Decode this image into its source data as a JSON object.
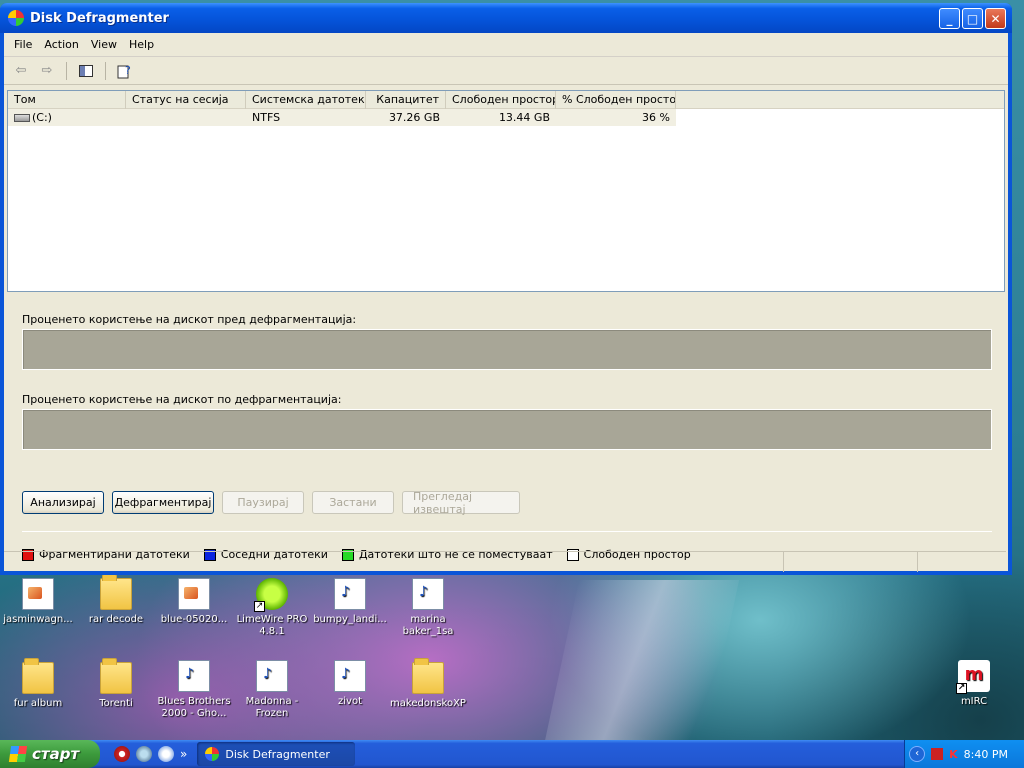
{
  "window": {
    "title": "Disk Defragmenter",
    "buttons": {
      "minimize": "_",
      "maximize": "□",
      "close": "✕"
    }
  },
  "menu": [
    "File",
    "Action",
    "View",
    "Help"
  ],
  "toolbar": {
    "back_icon": "back-arrow-icon",
    "forward_icon": "forward-arrow-icon",
    "show_hide_icon": "console-tree-icon",
    "help_icon": "help-icon"
  },
  "list": {
    "columns": [
      "Том",
      "Статус на сесија",
      "Системска датотека",
      "Капацитет",
      "Слободен простор",
      "% Слободен простор"
    ],
    "rows": [
      {
        "volume": "(C:)",
        "status": "",
        "filesystem": "NTFS",
        "capacity": "37.26 GB",
        "free": "13.44 GB",
        "pct_free": "36 %"
      }
    ]
  },
  "analysis": {
    "before_label": "Проценето користење на дискот пред дефрагментација:",
    "after_label": "Проценето користење на дискот по дефрагментација:"
  },
  "actions": {
    "analyze": "Анализирај",
    "defragment": "Дефрагментирај",
    "pause": "Паузирај",
    "stop": "Застани",
    "report": "Прегледај извештај"
  },
  "legend": [
    {
      "label": "Фрагментирани датотеки",
      "color": "#e01010"
    },
    {
      "label": "Соседни датотеки",
      "color": "#0a24e0"
    },
    {
      "label": "Датотеки што не се поместуваат",
      "color": "#27d927"
    },
    {
      "label": "Слободен простор",
      "color": "#ffffff"
    }
  ],
  "desktop_icons": [
    {
      "label": "jasminwagn...",
      "type": "file-img"
    },
    {
      "label": "rar decode",
      "type": "folder"
    },
    {
      "label": "blue-05020...",
      "type": "file-img"
    },
    {
      "label": "LimeWire PRO 4.8.1",
      "type": "limewire"
    },
    {
      "label": "bumpy_landi...",
      "type": "file-media"
    },
    {
      "label": "marina baker_1sa",
      "type": "file-media"
    },
    {
      "label": "fur album",
      "type": "folder"
    },
    {
      "label": "Torenti",
      "type": "folder"
    },
    {
      "label": "Blues Brothers 2000 - Gho...",
      "type": "file-media"
    },
    {
      "label": "Madonna - Frozen",
      "type": "file-media"
    },
    {
      "label": "zivot",
      "type": "file-media"
    },
    {
      "label": "makedonskoXP",
      "type": "folder"
    },
    {
      "label": "mIRC",
      "type": "mirc"
    }
  ],
  "taskbar": {
    "start_label": "старт",
    "task_title": "Disk Defragmenter",
    "more_label": "»",
    "clock": "8:40 PM"
  }
}
